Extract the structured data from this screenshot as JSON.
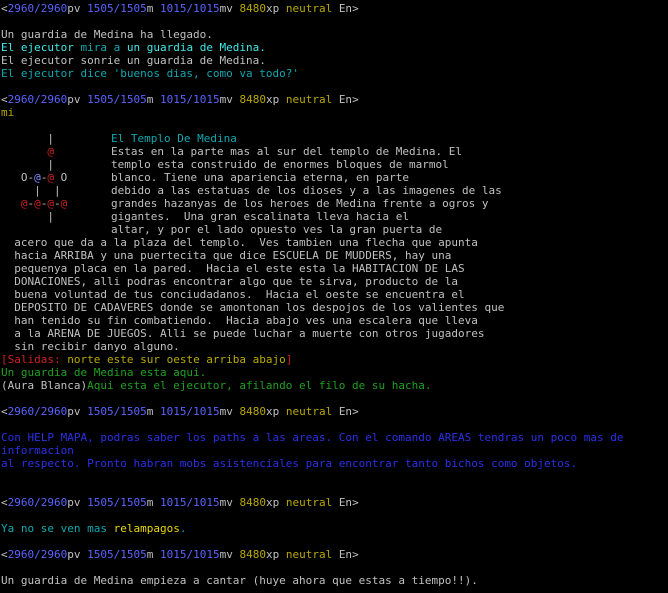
{
  "colors": {
    "background": "#000000",
    "text": "#c0c0c0",
    "stat_blue": "#5a64ff",
    "stat_yellow": "#b8a800",
    "cyan": "#10a8b0",
    "green": "#20a020",
    "red": "#d02020",
    "hint_blue": "#2a30e8"
  },
  "prompt": {
    "open": "<",
    "pv": "2960/2960",
    "pv_label": "pv",
    "m": "1505/1505",
    "m_label": "m",
    "mv": "1015/1015",
    "mv_label": "mv",
    "xp": "8480",
    "xp_label": "xp",
    "alignment": "neutral",
    "location": "En",
    "close": ">"
  },
  "block1": {
    "arrival": "Un guardia de Medina ha llegado.",
    "look_actor": "El ejecutor",
    "look_verb": " mira a ",
    "look_target": "un guardia de Medina",
    "look_end": ".",
    "smile": "El ejecutor sonrie un guardia de Medina.",
    "say": "El ejecutor dice 'buenos dias, como va todo?'"
  },
  "command": "mi",
  "room": {
    "title": "El Templo De Medina",
    "map": [
      [
        "       |"
      ],
      [
        "       @"
      ],
      [
        "       |"
      ],
      [
        "   O-@-@ O"
      ],
      [
        "     |  |"
      ],
      [
        "   @-@-@-@"
      ],
      [
        "       |"
      ]
    ],
    "desc_lines": [
      "Estas en la parte mas al sur del templo de Medina. El",
      "templo esta construido de enormes bloques de marmol",
      "blanco. Tiene una apariencia eterna, en parte",
      "debido a las estatuas de los dioses y a las imagenes de las",
      "grandes hazanyas de los heroes de Medina frente a ogros y",
      "gigantes.  Una gran escalinata lleva hacia el",
      "altar, y por el lado opuesto ves la gran puerta de"
    ],
    "body_lines": [
      "  acero que da a la plaza del templo.  Ves tambien una flecha que apunta",
      "  hacia ARRIBA y una puertecita que dice ESCUELA DE MUDDERS, hay una",
      "  pequenya placa en la pared.  Hacia el este esta la HABITACION DE LAS",
      "  DONACIONES, alli podras encontrar algo que te sirva, producto de la",
      "  buena voluntad de tus conciudadanos.  Hacia el oeste se encuentra el",
      "  DEPOSITO DE CADAVERES donde se amontonan los despojos de los valientes que",
      "  han tenido su fin combatiendo.  Hacia abajo ves una escalera que lleva",
      "  a la ARENA DE JUEGOS. Alli se puede luchar a muerte con otros jugadores",
      "  sin recibir danyo alguno."
    ],
    "exits_open": "[",
    "exits_label": "Salidas: ",
    "exits": "norte este sur oeste arriba abajo",
    "exits_close": "]",
    "mob1": "Un guardia de Medina esta aqui.",
    "aura": "(Aura Blanca)",
    "mob2": "Aqui esta el ejecutor, afilando el filo de su hacha."
  },
  "hint": {
    "line1": "Con HELP MAPA, podras saber los paths a las areas. Con el comando AREAS tendras un poco mas de",
    "line2": "informacion",
    "line3": "al respecto. Pronto habran mobs asistenciales para encontrar tanto bichos como objetos."
  },
  "weather": {
    "prefix": "Ya no se ven mas ",
    "word": "relampagos",
    "suffix": "."
  },
  "final": "Un guardia de Medina empieza a cantar (huye ahora que estas a tiempo!!)."
}
